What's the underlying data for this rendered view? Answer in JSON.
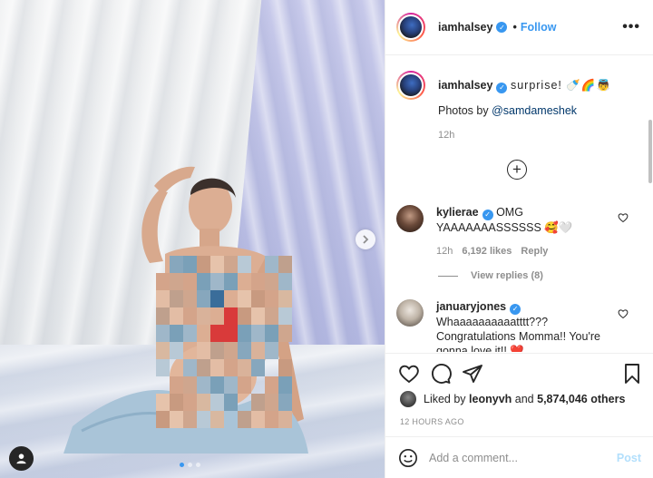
{
  "post": {
    "author": "iamhalsey",
    "follow_label": "Follow",
    "separator": "•",
    "more_icon": "more-horizontal-icon",
    "image_alt": "post photo",
    "carousel": {
      "count": 3,
      "active": 0
    }
  },
  "caption": {
    "username": "iamhalsey",
    "text": "surprise! 🍼🌈👼",
    "photos_prefix": "Photos by",
    "photos_handle": "@samdameshek",
    "time": "12h"
  },
  "comments": [
    {
      "username": "kylierae",
      "text": "OMG YAAAAAAASSSSSS 🥰🤍",
      "time": "12h",
      "likes": "6,192 likes",
      "reply_label": "Reply",
      "view_replies": "View replies (8)"
    },
    {
      "username": "januaryjones",
      "text": "Whaaaaaaaaaatttt??? Congratulations Momma!! You're gonna love it!! ❤️"
    }
  ],
  "likes_line": {
    "prefix": "Liked by",
    "user": "leonyvh",
    "and": "and",
    "count": "5,874,046 others"
  },
  "timestamp": "12 HOURS AGO",
  "comment_input": {
    "placeholder": "Add a comment...",
    "post_label": "Post"
  },
  "colors": {
    "accent": "#3897f0",
    "post_disabled": "#b2dffc",
    "muted": "#8e8e8e"
  }
}
